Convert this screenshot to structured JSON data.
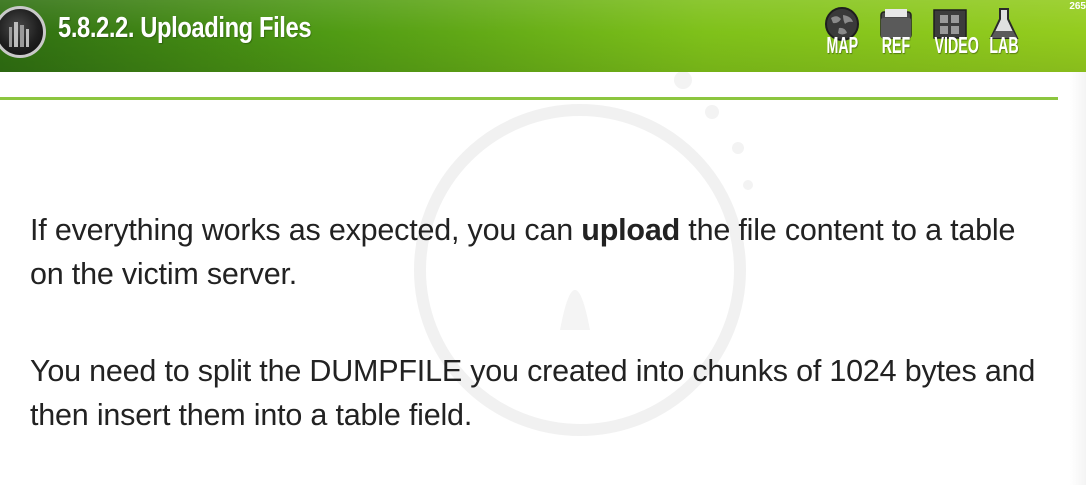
{
  "header": {
    "title": "5.8.2.2. Uploading Files",
    "page_number": "265",
    "nav": [
      {
        "label": "MAP",
        "icon": "globe-icon"
      },
      {
        "label": "REF",
        "icon": "folder-icon"
      },
      {
        "label": "VIDEO",
        "icon": "film-icon"
      },
      {
        "label": "LAB",
        "icon": "flask-icon"
      }
    ]
  },
  "content": {
    "para1": {
      "before": "If everything works as expected, you can ",
      "bold": "upload",
      "after": " the file content to a table on the victim server."
    },
    "para2": "You need to split the DUMPFILE you created into chunks of 1024 bytes and then insert them into a table field."
  },
  "colors": {
    "header_start": "#2f6f12",
    "header_end": "#94cc1e",
    "rule": "#8cc63f",
    "text": "#222222"
  }
}
